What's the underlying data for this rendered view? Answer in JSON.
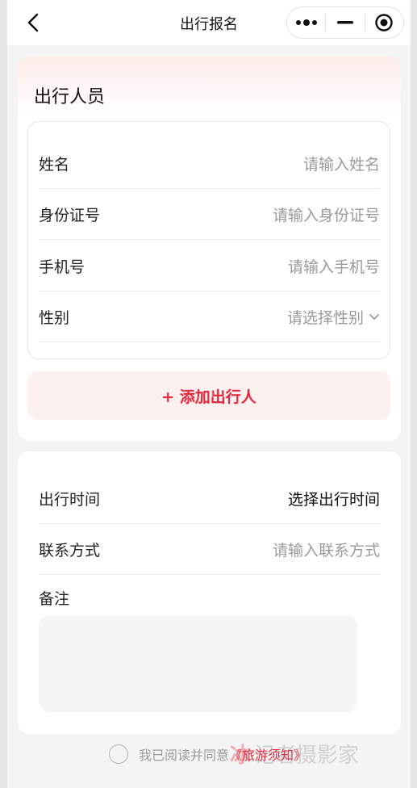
{
  "navbar": {
    "title": "出行报名",
    "back_icon": "chevron-left-icon",
    "capsule": [
      "more-dots-icon",
      "minimize-icon",
      "target-icon"
    ]
  },
  "travelers": {
    "title": "出行人员",
    "fields": [
      {
        "label": "姓名",
        "placeholder": "请输入姓名"
      },
      {
        "label": "身份证号",
        "placeholder": "请输入身份证号"
      },
      {
        "label": "手机号",
        "placeholder": "请输入手机号"
      },
      {
        "label": "性别",
        "placeholder": "请选择性别"
      }
    ],
    "add_button": "+ 添加出行人"
  },
  "trip": {
    "time_label": "出行时间",
    "time_value": "选择出行时间",
    "contact_label": "联系方式",
    "contact_placeholder": "请输入联系方式",
    "remark_label": "备注"
  },
  "agreement": {
    "prefix": "我已阅读并同意",
    "link": "《旅游须知》"
  },
  "watermark": {
    "logo": "冰",
    "text": "记者摄影家"
  },
  "colors": {
    "accent": "#e8253a",
    "add_bg": "#fdf1f0",
    "placeholder": "#9a9a9a"
  }
}
